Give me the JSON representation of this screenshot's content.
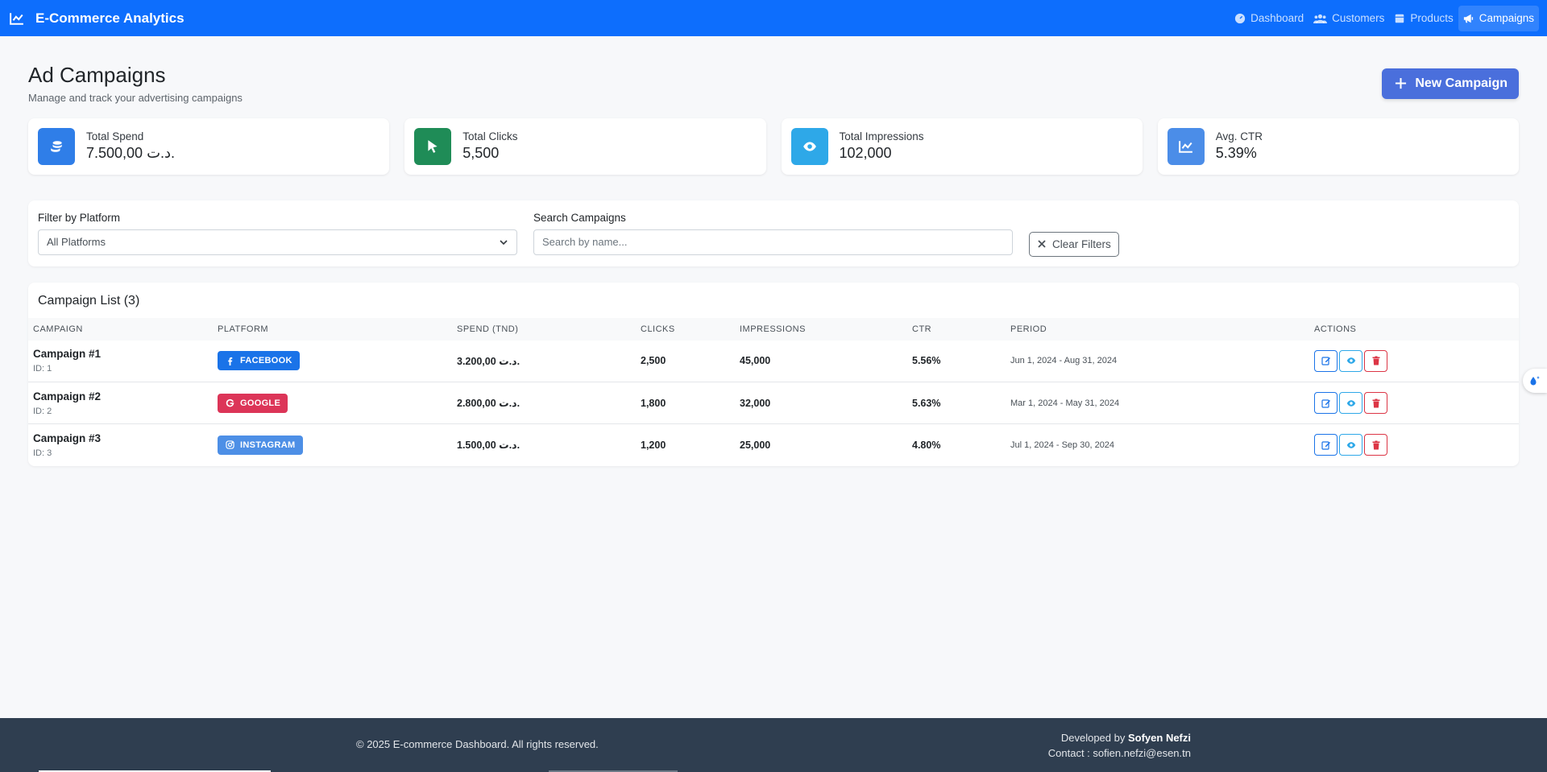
{
  "navbar": {
    "brand": "E-Commerce Analytics",
    "links": [
      {
        "label": "Dashboard",
        "icon": "dashboard-gauge-icon",
        "active": false
      },
      {
        "label": "Customers",
        "icon": "users-icon",
        "active": false
      },
      {
        "label": "Products",
        "icon": "box-icon",
        "active": false
      },
      {
        "label": "Campaigns",
        "icon": "megaphone-icon",
        "active": true
      }
    ]
  },
  "header": {
    "title": "Ad Campaigns",
    "subtitle": "Manage and track your advertising campaigns",
    "new_button": "New Campaign"
  },
  "stats": [
    {
      "label": "Total Spend",
      "value": "7.500,00 د.ت.",
      "icon": "coins-icon",
      "color": "#2f7ee8"
    },
    {
      "label": "Total Clicks",
      "value": "5,500",
      "icon": "cursor-icon",
      "color": "#1f8c57"
    },
    {
      "label": "Total Impressions",
      "value": "102,000",
      "icon": "eye-icon",
      "color": "#2ea8e8"
    },
    {
      "label": "Avg. CTR",
      "value": "5.39%",
      "icon": "chart-line-icon",
      "color": "#4b8de8"
    }
  ],
  "filters": {
    "platform_label": "Filter by Platform",
    "platform_value": "All Platforms",
    "search_label": "Search Campaigns",
    "search_placeholder": "Search by name...",
    "clear_button": "Clear Filters"
  },
  "table": {
    "title": "Campaign List (3)",
    "columns": [
      "CAMPAIGN",
      "PLATFORM",
      "SPEND (TND)",
      "CLICKS",
      "IMPRESSIONS",
      "CTR",
      "PERIOD",
      "ACTIONS"
    ],
    "rows": [
      {
        "name": "Campaign #1",
        "id": "ID: 1",
        "platform": "FACEBOOK",
        "platform_color": "#1a73e8",
        "spend": "3.200,00 د.ت.",
        "clicks": "2,500",
        "impressions": "45,000",
        "ctr": "5.56%",
        "period": "Jun 1, 2024 - Aug 31, 2024"
      },
      {
        "name": "Campaign #2",
        "id": "ID: 2",
        "platform": "GOOGLE",
        "platform_color": "#dc3558",
        "spend": "2.800,00 د.ت.",
        "clicks": "1,800",
        "impressions": "32,000",
        "ctr": "5.63%",
        "period": "Mar 1, 2024 - May 31, 2024"
      },
      {
        "name": "Campaign #3",
        "id": "ID: 3",
        "platform": "INSTAGRAM",
        "platform_color": "#4d8fe6",
        "spend": "1.500,00 د.ت.",
        "clicks": "1,200",
        "impressions": "25,000",
        "ctr": "4.80%",
        "period": "Jul 1, 2024 - Sep 30, 2024"
      }
    ]
  },
  "footer": {
    "copyright": "© 2025 E-commerce Dashboard. All rights reserved.",
    "developed_by_label": "Developed by",
    "developer": "Sofyen Nefzi",
    "contact": "Contact : sofien.nefzi@esen.tn"
  }
}
